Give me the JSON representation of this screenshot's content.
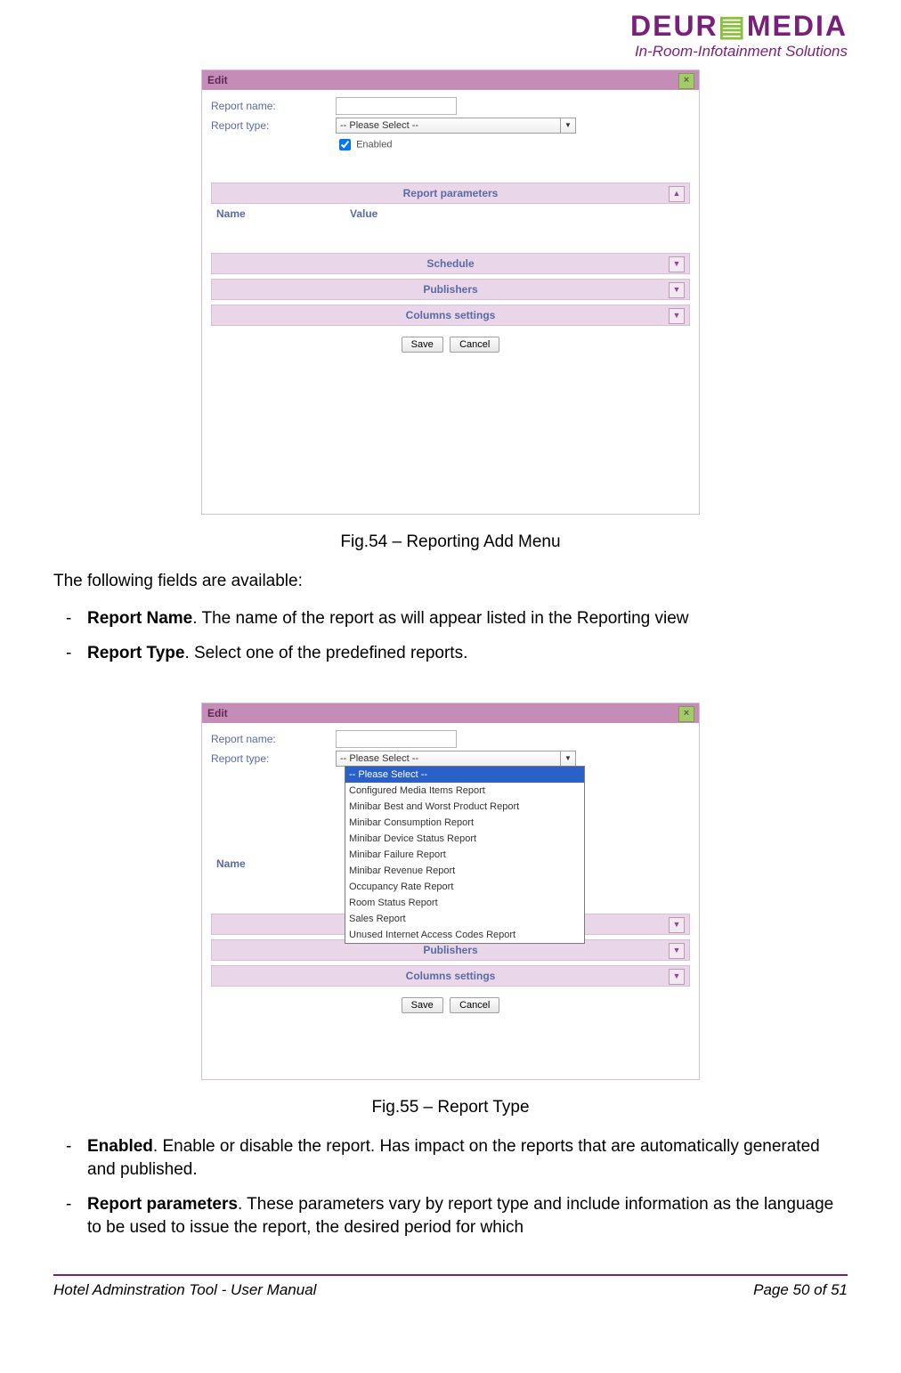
{
  "logo": {
    "text_pre": "DEUR",
    "text_post": "MEDIA",
    "sub": "In-Room-Infotainment Solutions"
  },
  "fig54": {
    "title": "Edit",
    "report_name_label": "Report name:",
    "report_type_label": "Report type:",
    "select_placeholder": "-- Please Select --",
    "enabled_label": "Enabled",
    "section_params": "Report parameters",
    "col_name": "Name",
    "col_value": "Value",
    "section_schedule": "Schedule",
    "section_publishers": "Publishers",
    "section_columns": "Columns settings",
    "save": "Save",
    "cancel": "Cancel"
  },
  "caption54": "Fig.54 – Reporting Add Menu",
  "intro": "The following fields are available:",
  "bullets1": {
    "b1_bold": "Report Name",
    "b1_rest": ". The name of the report as will appear listed in the Reporting view",
    "b2_bold": "Report Type",
    "b2_rest": ". Select one of the predefined reports."
  },
  "fig55": {
    "title": "Edit",
    "report_name_label": "Report name:",
    "report_type_label": "Report type:",
    "select_placeholder": "-- Please Select --",
    "options": [
      "-- Please Select --",
      "Configured Media Items Report",
      "Minibar Best and Worst Product Report",
      "Minibar Consumption Report",
      "Minibar Device Status Report",
      "Minibar Failure Report",
      "Minibar Revenue Report",
      "Occupancy Rate Report",
      "Room Status Report",
      "Sales Report",
      "Unused Internet Access Codes Report"
    ],
    "col_name": "Name",
    "section_publishers": "Publishers",
    "section_columns": "Columns settings",
    "save": "Save",
    "cancel": "Cancel"
  },
  "caption55": "Fig.55 – Report Type",
  "bullets2": {
    "b3_bold": "Enabled",
    "b3_rest": ". Enable or disable the report. Has impact on the reports that are automatically generated and published.",
    "b4_bold": "Report parameters",
    "b4_rest": ". These parameters vary by report type and include information as the language to be used to issue the report, the desired period for which"
  },
  "footer": {
    "left": "Hotel Adminstration Tool - User Manual",
    "right": "Page 50 of 51"
  }
}
